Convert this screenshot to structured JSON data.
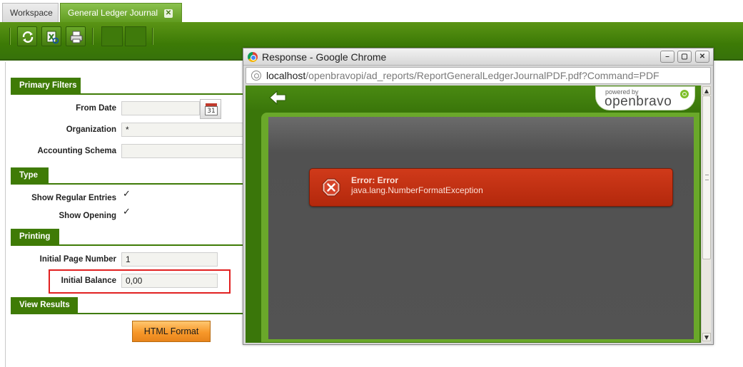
{
  "tabs": {
    "workspace": "Workspace",
    "general_ledger": "General Ledger Journal",
    "close_glyph": "✕"
  },
  "toolbar": {
    "buttons": [
      "refresh-icon",
      "export-icon",
      "print-icon"
    ]
  },
  "sections": {
    "primary_filters": "Primary Filters",
    "type": "Type",
    "printing": "Printing",
    "view_results": "View Results"
  },
  "fields": {
    "from_date_label": "From Date",
    "from_date_value": "",
    "calendar_day": "31",
    "organization_label": "Organization",
    "organization_value": "*",
    "accounting_schema_label": "Accounting Schema",
    "accounting_schema_value": "",
    "show_regular_label": "Show Regular Entries",
    "show_opening_label": "Show Opening",
    "initial_page_label": "Initial Page Number",
    "initial_page_value": "1",
    "initial_balance_label": "Initial Balance",
    "initial_balance_value": "0,00"
  },
  "checkbox_glyph": "✓",
  "html_format_label": "HTML Format",
  "popup": {
    "title": "Response - Google Chrome",
    "url_host": "localhost",
    "url_path": "/openbravopi/ad_reports/ReportGeneralLedgerJournalPDF.pdf?Command=PDF",
    "logo_powered": "powered by",
    "logo_name": "openbravo",
    "error_title": "Error: Error",
    "error_message": "java.lang.NumberFormatException",
    "win_buttons": [
      "–",
      "▢",
      "✕"
    ],
    "scroll_up": "▲",
    "scroll_down": "▼"
  },
  "colors": {
    "brand_green": "#3f7b06",
    "error_red": "#c0341a",
    "highlight_red": "#e12020",
    "button_orange": "#f7982a"
  }
}
